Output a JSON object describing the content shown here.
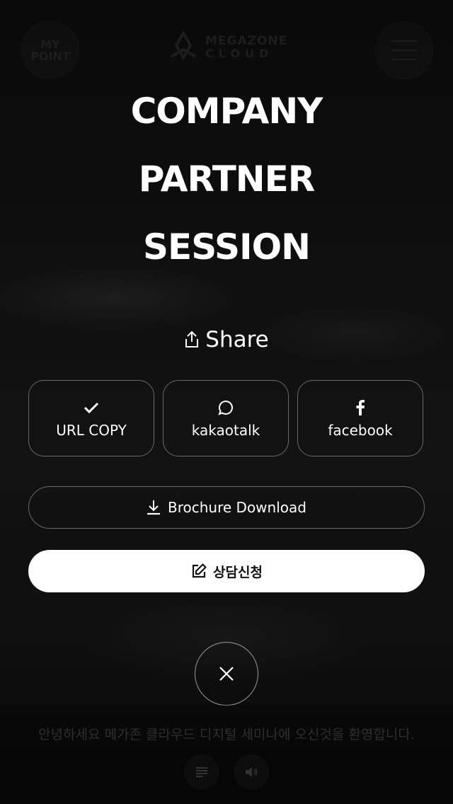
{
  "header": {
    "mypoint_line1": "MY",
    "mypoint_line2": "POINT",
    "logo_line1": "MEGAZONE",
    "logo_line2": "CLOUD"
  },
  "menu": {
    "items": [
      {
        "label": "COMPANY"
      },
      {
        "label": "PARTNER"
      },
      {
        "label": "SESSION"
      }
    ]
  },
  "share": {
    "label": "Share",
    "buttons": [
      {
        "label": "URL COPY",
        "icon": "check-icon"
      },
      {
        "label": "kakaotalk",
        "icon": "speech-bubble-icon"
      },
      {
        "label": "facebook",
        "icon": "facebook-icon"
      }
    ]
  },
  "actions": {
    "brochure_label": "Brochure Download",
    "consult_label": "상담신청"
  },
  "bottom": {
    "caption": "안녕하세요 메가존 클라우드 디지털 세미나에 오신것을 환영합니다."
  },
  "colors": {
    "background": "#151515",
    "text": "#ffffff",
    "button_border": "#6a6a6a",
    "primary_button_bg": "#ffffff",
    "primary_button_text": "#111111"
  }
}
